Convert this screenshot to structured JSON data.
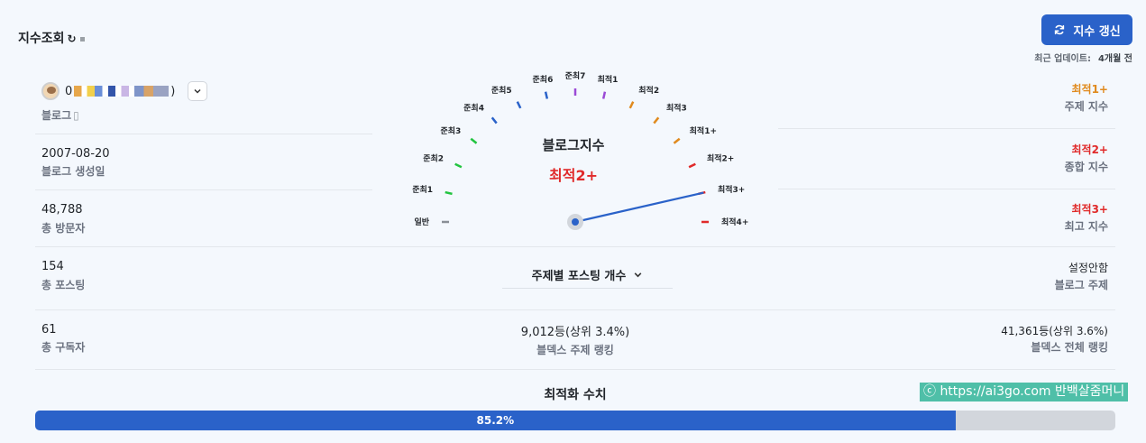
{
  "header": {
    "title": "지수조회",
    "refresh_label": "지수 갱신",
    "last_update_label": "최근 업데이트:",
    "last_update_value": "4개월 전"
  },
  "profile": {
    "blog_name_prefix": "0",
    "blog_name_suffix": ")",
    "subtitle": "블로그"
  },
  "stats_left": [
    {
      "value": "2007-08-20",
      "label": "블로그 생성일"
    },
    {
      "value": "48,788",
      "label": "총 방문자"
    },
    {
      "value": "154",
      "label": "총 포스팅"
    },
    {
      "value": "61",
      "label": "총 구독자"
    }
  ],
  "stats_right": [
    {
      "value": "최적1+",
      "label": "주제 지수",
      "color": "#e08a1e"
    },
    {
      "value": "최적2+",
      "label": "종합 지수",
      "color": "#e02a2a"
    },
    {
      "value": "최적3+",
      "label": "최고 지수",
      "color": "#e02a2a"
    },
    {
      "value": "설정안함",
      "label": "블로그 주제",
      "color": "#1f2328"
    },
    {
      "value": "41,361등(상위 3.6%)",
      "label": "블덱스 전체 랭킹",
      "color": "#1f2328"
    }
  ],
  "gauge": {
    "title": "블로그지수",
    "value": "최적2+",
    "current_level_index": 13,
    "levels": [
      {
        "label": "일반",
        "color": "#8a8f96"
      },
      {
        "label": "준최1",
        "color": "#22c440"
      },
      {
        "label": "준최2",
        "color": "#22c440"
      },
      {
        "label": "준최3",
        "color": "#22c440"
      },
      {
        "label": "준최4",
        "color": "#2a62c9"
      },
      {
        "label": "준최5",
        "color": "#2a62c9"
      },
      {
        "label": "준최6",
        "color": "#2a62c9"
      },
      {
        "label": "준최7",
        "color": "#9b4ad6"
      },
      {
        "label": "최적1",
        "color": "#9b4ad6"
      },
      {
        "label": "최적2",
        "color": "#e08a1e"
      },
      {
        "label": "최적3",
        "color": "#e08a1e"
      },
      {
        "label": "최적1+",
        "color": "#e08a1e"
      },
      {
        "label": "최적2+",
        "color": "#e02a2a"
      },
      {
        "label": "최적3+",
        "color": "#e02a2a"
      },
      {
        "label": "최적4+",
        "color": "#e02a2a"
      }
    ],
    "needle_color": "#2a62c9"
  },
  "topic_select": {
    "label": "주제별 포스팅 개수"
  },
  "center_rank": {
    "value": "9,012등(상위 3.4%)",
    "label": "블덱스 주제 랭킹"
  },
  "optimization": {
    "title": "최적화 수치",
    "percent": 85.2,
    "percent_label": "85.2%"
  },
  "watermark": "ⓒ https://ai3go.com 반백살줌머니"
}
